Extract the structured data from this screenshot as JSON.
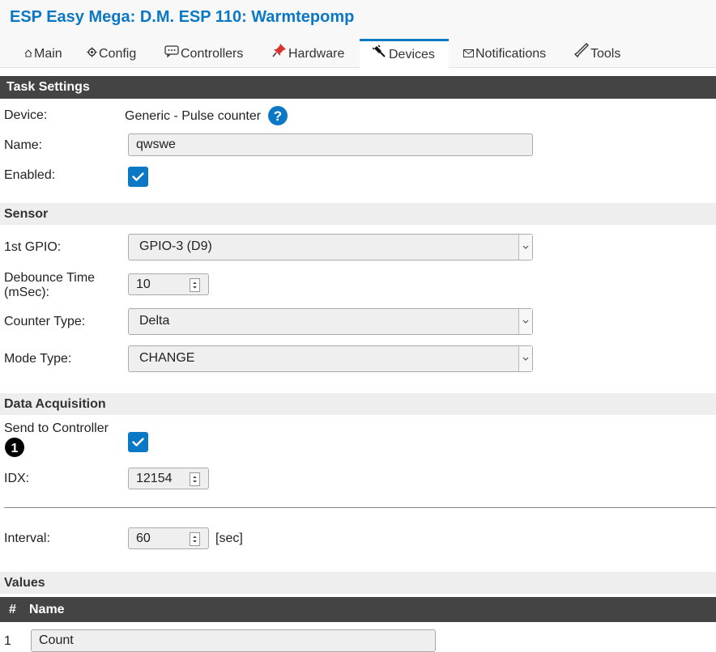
{
  "header": {
    "title": "ESP Easy Mega: D.M. ESP 110: Warmtepomp",
    "tabs": [
      {
        "label": "Main",
        "icon": "home-icon"
      },
      {
        "label": "Config",
        "icon": "gear-icon"
      },
      {
        "label": "Controllers",
        "icon": "chat-icon"
      },
      {
        "label": "Hardware",
        "icon": "pin-icon"
      },
      {
        "label": "Devices",
        "icon": "plug-icon",
        "active": true
      },
      {
        "label": "Notifications",
        "icon": "envelope-icon"
      },
      {
        "label": "Tools",
        "icon": "wrench-icon"
      }
    ],
    "accent_color": "#0b78c6"
  },
  "task": {
    "header": "Task Settings",
    "device_label": "Device:",
    "device_value": "Generic - Pulse counter",
    "name_label": "Name:",
    "name_value": "qwswe",
    "enabled_label": "Enabled:",
    "enabled": true
  },
  "sensor": {
    "header": "Sensor",
    "gpio_label": "1st GPIO:",
    "gpio_value": "GPIO-3 (D9)",
    "debounce_label_1": "Debounce Time",
    "debounce_label_2": "(mSec):",
    "debounce_value": "10",
    "counter_type_label": "Counter Type:",
    "counter_type_value": "Delta",
    "mode_type_label": "Mode Type:",
    "mode_type_value": "CHANGE"
  },
  "acquisition": {
    "header": "Data Acquisition",
    "send_label": "Send to Controller",
    "send_badge": "1",
    "send_enabled": true,
    "idx_label": "IDX:",
    "idx_value": "12154",
    "interval_label": "Interval:",
    "interval_value": "60",
    "interval_unit": "[sec]"
  },
  "values": {
    "header": "Values",
    "col_number": "#",
    "col_name": "Name",
    "rows": [
      {
        "number": "1",
        "name": "Count"
      }
    ]
  }
}
